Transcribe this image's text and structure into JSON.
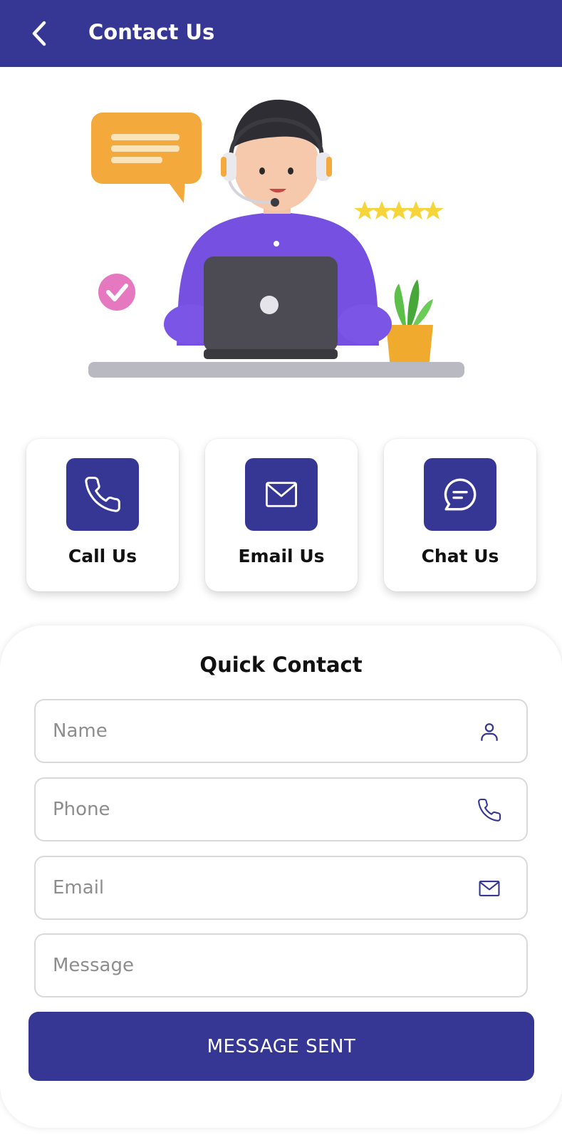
{
  "header": {
    "title": "Contact Us",
    "back_icon": "chevron-left-icon",
    "background": "#363795"
  },
  "actions": [
    {
      "label": "Call Us",
      "icon": "phone-icon"
    },
    {
      "label": "Email Us",
      "icon": "mail-icon"
    },
    {
      "label": "Chat Us",
      "icon": "chat-icon"
    }
  ],
  "quick_contact": {
    "title": "Quick Contact",
    "fields": [
      {
        "placeholder": "Name",
        "value": "",
        "icon": "user-icon"
      },
      {
        "placeholder": "Phone",
        "value": "",
        "icon": "phone-icon"
      },
      {
        "placeholder": "Email",
        "value": "",
        "icon": "mail-icon"
      },
      {
        "placeholder": "Message",
        "value": ""
      }
    ],
    "submit_label": "MESSAGE SENT"
  },
  "illustration": {
    "rating_stars": 5
  },
  "colors": {
    "primary": "#363795",
    "card_bg": "#ffffff",
    "border": "#d9d9d9",
    "placeholder": "#8d8d8d"
  }
}
